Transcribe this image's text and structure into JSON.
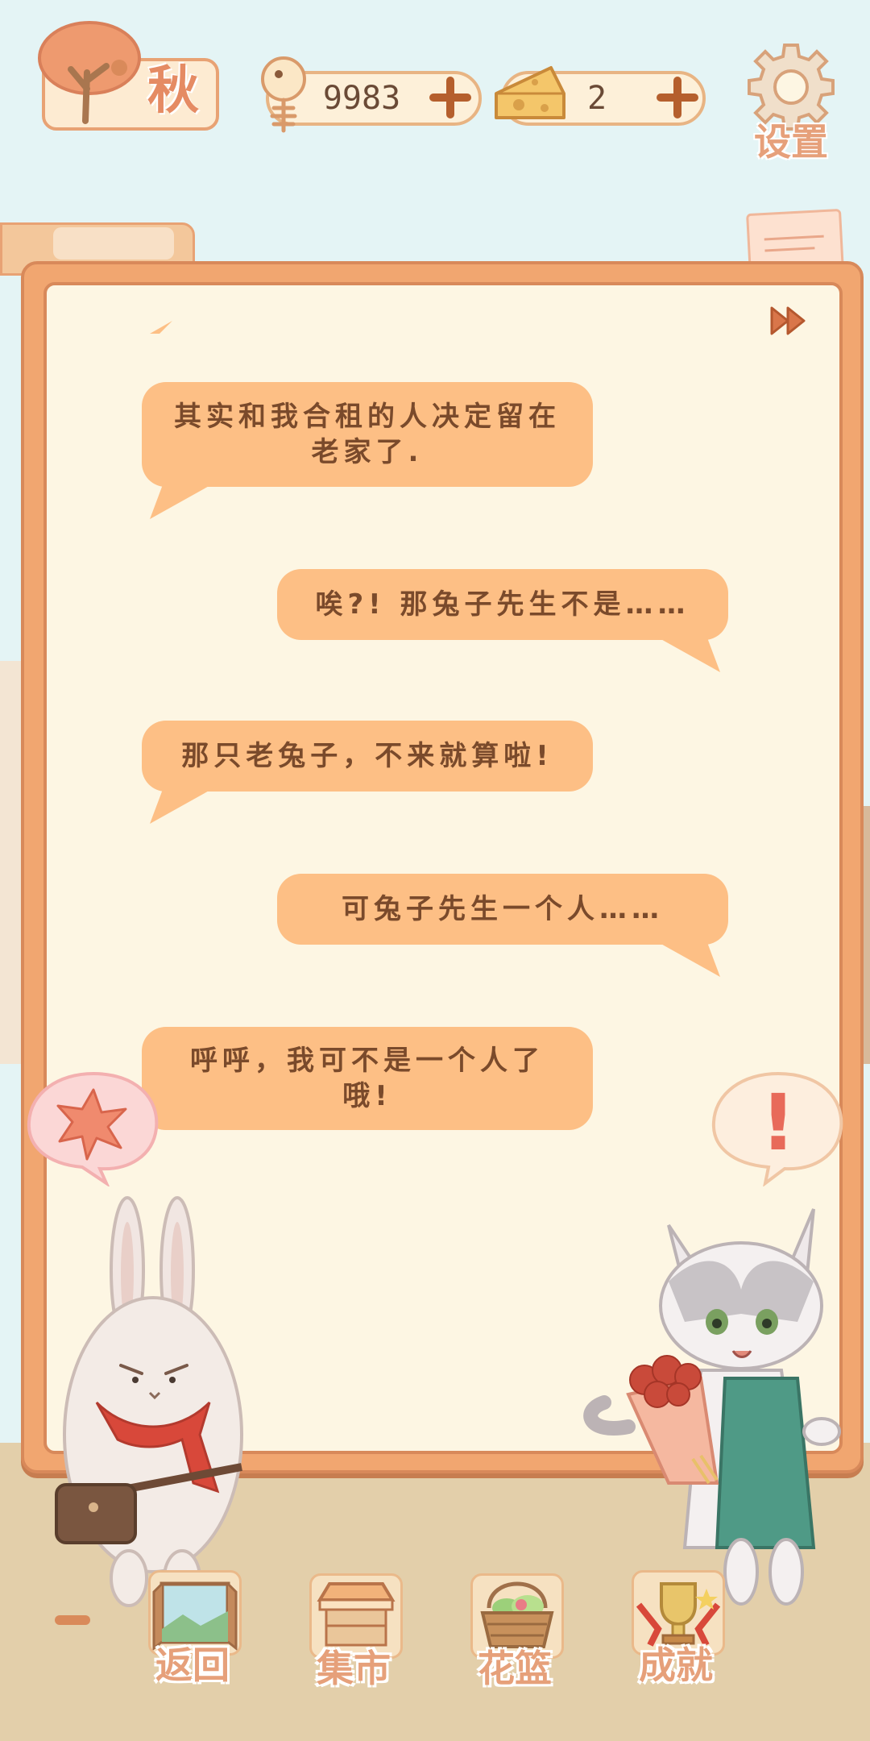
{
  "header": {
    "season_text": "秋",
    "fish_count": "9983",
    "cheese_count": "2",
    "settings_label": "设置"
  },
  "dialog": {
    "messages": [
      {
        "side": "left",
        "text": "其实和我合租的人决定留在老家了."
      },
      {
        "side": "right",
        "text": "唉?! 那兔子先生不是……"
      },
      {
        "side": "left",
        "text": "那只老兔子，不来就算啦!"
      },
      {
        "side": "right",
        "text": "可兔子先生一个人……"
      },
      {
        "side": "left",
        "text": "呼呼，我可不是一个人了哦!"
      }
    ],
    "right_thought_mark": "!"
  },
  "nav": {
    "back_label": "返回",
    "market_label": "集市",
    "basket_label": "花篮",
    "achievements_label": "成就"
  },
  "colors": {
    "board": "#f1a670",
    "bubble": "#fdbf85",
    "paper": "#fdf6e3",
    "sky": "#e4f4f5",
    "ground": "#e3cfaa",
    "label": "#e6a07a"
  },
  "icons": {
    "season": "tree-icon",
    "fish": "fish-bone-icon",
    "cheese": "cheese-icon",
    "settings": "gear-icon",
    "skip": "fast-forward-icon",
    "left_thought": "maple-leaf-icon"
  }
}
